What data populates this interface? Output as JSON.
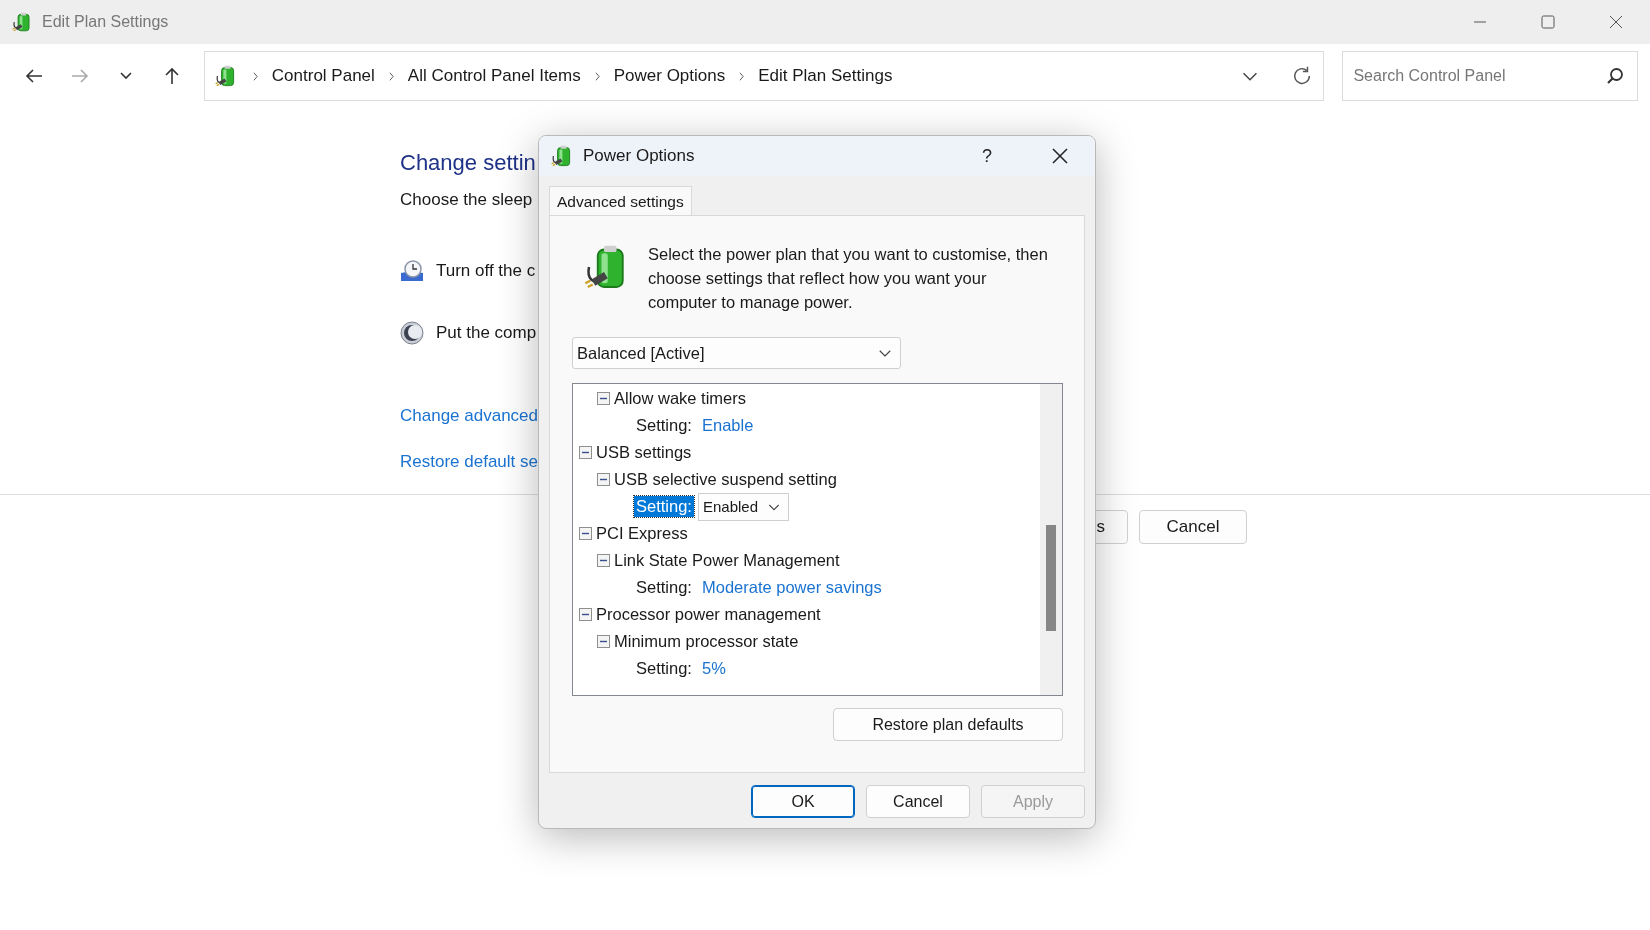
{
  "window": {
    "title": "Edit Plan Settings"
  },
  "nav": {
    "buttons": [
      {
        "kind": "back",
        "disabled": false
      },
      {
        "kind": "forward",
        "disabled": true
      },
      {
        "kind": "recent",
        "disabled": false
      },
      {
        "kind": "up",
        "disabled": false
      }
    ],
    "breadcrumbs": [
      "Control Panel",
      "All Control Panel Items",
      "Power Options",
      "Edit Plan Settings"
    ],
    "search": {
      "placeholder": "Search Control Panel"
    }
  },
  "page": {
    "heading": "Change settin",
    "subtitle": "Choose the sleep",
    "settings": [
      {
        "kind": "display",
        "label": "Turn off the c"
      },
      {
        "kind": "sleep",
        "label": "Put the comp"
      }
    ],
    "links": [
      "Change advanced",
      "Restore default se"
    ],
    "buttons": [
      {
        "label": "s"
      },
      {
        "label": "Cancel"
      }
    ]
  },
  "dialog": {
    "title": "Power Options",
    "help": "?",
    "tabs": [
      {
        "label": "Advanced settings",
        "selected": true
      }
    ],
    "description": "Select the power plan that you want to customise, then choose settings that reflect how you want your computer to manage power.",
    "plan": {
      "value": "Balanced [Active]"
    },
    "tree": {
      "items": [
        {
          "children": [
            {
              "label": "Allow wake timers",
              "expanded": true,
              "children": [
                {
                  "kind": "value",
                  "label": "Setting:",
                  "value": "Enable",
                  "selected": false
                }
              ]
            }
          ]
        },
        {
          "label": "USB settings",
          "expanded": true,
          "children": [
            {
              "label": "USB selective suspend setting",
              "expanded": true,
              "children": [
                {
                  "kind": "dropdown",
                  "label": "Setting:",
                  "value": "Enabled",
                  "selected": true
                }
              ]
            }
          ]
        },
        {
          "label": "PCI Express",
          "expanded": true,
          "children": [
            {
              "label": "Link State Power Management",
              "expanded": true,
              "children": [
                {
                  "kind": "value",
                  "label": "Setting:",
                  "value": "Moderate power savings",
                  "selected": false
                }
              ]
            }
          ]
        },
        {
          "label": "Processor power management",
          "expanded": true,
          "children": [
            {
              "label": "Minimum processor state",
              "expanded": true,
              "children": [
                {
                  "kind": "value",
                  "label": "Setting:",
                  "value": "5%",
                  "selected": false
                }
              ]
            }
          ]
        }
      ]
    },
    "restore_button": "Restore plan defaults",
    "buttons": [
      {
        "label": "OK",
        "default": true,
        "disabled": false
      },
      {
        "label": "Cancel",
        "default": false,
        "disabled": false
      },
      {
        "label": "Apply",
        "default": false,
        "disabled": true
      }
    ]
  }
}
